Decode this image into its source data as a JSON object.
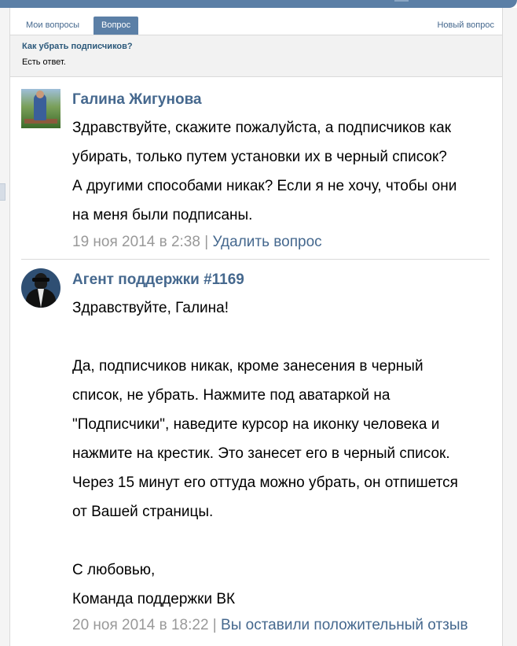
{
  "tabs": {
    "my_questions": "Мои вопросы",
    "question": "Вопрос",
    "new_question": "Новый вопрос"
  },
  "summary": {
    "title": "Как убрать подписчиков?",
    "status": "Есть ответ."
  },
  "messages": [
    {
      "author": "Галина Жигунова",
      "lines": [
        "Здравствуйте, скажите пожалуйста, а подписчиков как",
        "убирать, только путем установки их в черный список?",
        "А другими способами никак? Если я не хочу, чтобы они",
        "на меня были подписаны."
      ],
      "date": "19 ноя 2014 в 2:38",
      "separator": "|",
      "action": "Удалить вопрос"
    },
    {
      "author": "Агент поддержки #1169",
      "lines": [
        "Здравствуйте, Галина!",
        "",
        "Да, подписчиков никак, кроме занесения в черный",
        "список, не убрать. Нажмите под аватаркой на",
        "\"Подписчики\", наведите курсор на иконку человека и",
        "нажмите на крестик. Это занесет его в черный список.",
        "Через 15 минут его оттуда можно убрать, он отпишется",
        "от Вашей страницы.",
        "",
        "С любовью,",
        "Команда поддержки ВК"
      ],
      "date": "20 ноя 2014 в 18:22",
      "separator": "|",
      "feedback": "Вы оставили положительный отзыв"
    }
  ],
  "colors": {
    "header_blue": "#5b7fa6",
    "link_blue": "#45688e",
    "meta_grey": "#999999"
  },
  "icons": {
    "side_handle": "collapse-handle-icon"
  }
}
